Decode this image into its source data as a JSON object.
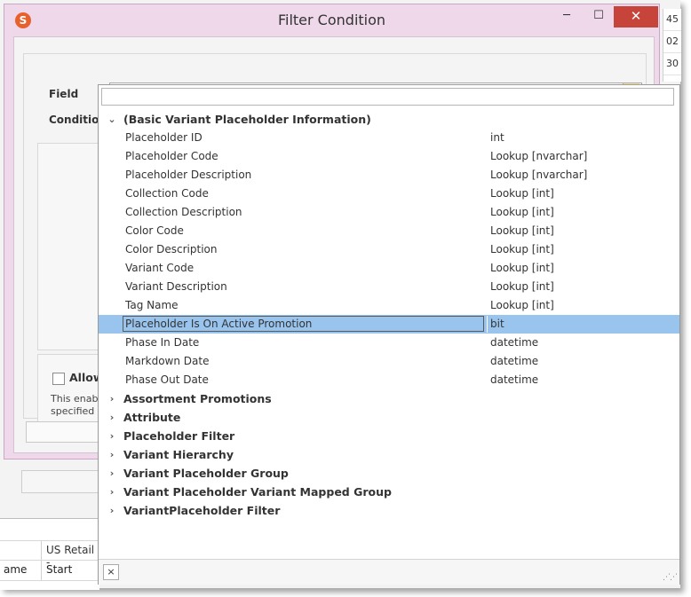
{
  "background": {
    "right_column_values": [
      "45",
      "02",
      "30"
    ],
    "grid": {
      "row1_value": "US Retail -",
      "row2_col1": "ame",
      "row2_col2": "Start"
    }
  },
  "dialog": {
    "title": "Filter Condition",
    "icon": "app-logo-icon",
    "window_buttons": {
      "minimize": "─",
      "maximize": "☐",
      "close": "✕"
    },
    "field_label": "Field",
    "condition_label": "Condition",
    "allow_label": "Allow d",
    "hint_line1": "This enables",
    "hint_line2": "specified wil"
  },
  "dropdown": {
    "search_value": "",
    "clear_icon": "×",
    "groups": [
      {
        "label": "(Basic Variant Placeholder Information)",
        "expanded": true,
        "items": [
          {
            "name": "Placeholder ID",
            "type": "int"
          },
          {
            "name": "Placeholder Code",
            "type": "Lookup [nvarchar]"
          },
          {
            "name": "Placeholder Description",
            "type": "Lookup [nvarchar]"
          },
          {
            "name": "Collection Code",
            "type": "Lookup [int]"
          },
          {
            "name": "Collection Description",
            "type": "Lookup [int]"
          },
          {
            "name": "Color Code",
            "type": "Lookup [int]"
          },
          {
            "name": "Color Description",
            "type": "Lookup [int]"
          },
          {
            "name": "Variant Code",
            "type": "Lookup [int]"
          },
          {
            "name": "Variant Description",
            "type": "Lookup [int]"
          },
          {
            "name": "Tag Name",
            "type": "Lookup [int]"
          },
          {
            "name": "Placeholder Is On Active Promotion",
            "type": "bit",
            "selected": true
          },
          {
            "name": "Phase In Date",
            "type": "datetime"
          },
          {
            "name": "Markdown Date",
            "type": "datetime"
          },
          {
            "name": "Phase Out Date",
            "type": "datetime"
          }
        ]
      },
      {
        "label": "Assortment Promotions",
        "expanded": false
      },
      {
        "label": "Attribute",
        "expanded": false
      },
      {
        "label": "Placeholder Filter",
        "expanded": false
      },
      {
        "label": "Variant Hierarchy",
        "expanded": false
      },
      {
        "label": "Variant Placeholder Group",
        "expanded": false
      },
      {
        "label": "Variant Placeholder Variant Mapped Group",
        "expanded": false
      },
      {
        "label": "VariantPlaceholder Filter",
        "expanded": false
      }
    ]
  },
  "colors": {
    "dialog_frame": "#eed8ea",
    "selection": "#99c4ee",
    "close_button": "#c7443a",
    "dropdown_button": "#fbe79a"
  }
}
